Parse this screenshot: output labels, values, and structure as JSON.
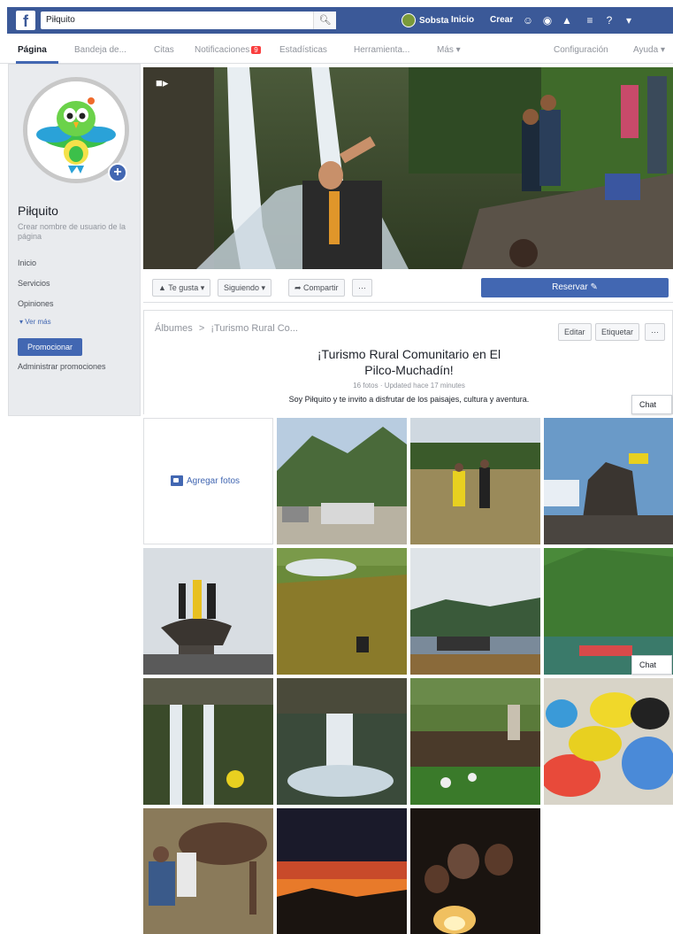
{
  "topbar": {
    "search_value": "Piłquito",
    "search_icon": "search-icon",
    "user_name": "Sobsta",
    "link_home": "Inicio",
    "link_create": "Crear",
    "icons": [
      "friends-icon",
      "messenger-icon",
      "notifications-icon",
      "help-icon",
      "question-icon",
      "dropdown-icon"
    ]
  },
  "tabs": {
    "items": [
      "Página",
      "Bandeja de...",
      "Citas",
      "Notificaciones",
      "Estadísticas",
      "Herramienta...",
      "Más ▾",
      "Configuración",
      "Ayuda ▾"
    ],
    "notif_count": "9"
  },
  "sidebar": {
    "page_name": "Piłquito",
    "username_prompt": "Crear nombre de usuario de la página",
    "links": [
      "Inicio",
      "Servicios",
      "Opiniones"
    ],
    "see_more": "▾ Ver más",
    "promote": "Promocionar",
    "manage_promotions": "Administrar promociones"
  },
  "actions": {
    "like": "▲ Te gusta ▾",
    "follow": "Siguiendo ▾",
    "share": "➦ Compartir",
    "more": "···",
    "reserve": "Reservar ✎"
  },
  "album": {
    "crumb_albums": "Álbumes",
    "crumb_sep": ">",
    "crumb_current": "¡Turismo Rural Co...",
    "edit": "Editar",
    "more_label": "Etiquetar",
    "ellipsis": "···",
    "title_line1": "¡Turismo Rural Comunitario en El",
    "title_line2": "Pilco-Muchadín!",
    "meta": "16 fotos · Updated hace 17 minutes",
    "description": "Soy Piłquito y te invito a disfrutar de los paisajes, cultura y aventura.",
    "add_photos": "Agregar fotos"
  },
  "chat": {
    "label": "Chat"
  },
  "colors": {
    "brand": "#3b5998",
    "button": "#4267b2",
    "badge": "#fa3e3e"
  }
}
